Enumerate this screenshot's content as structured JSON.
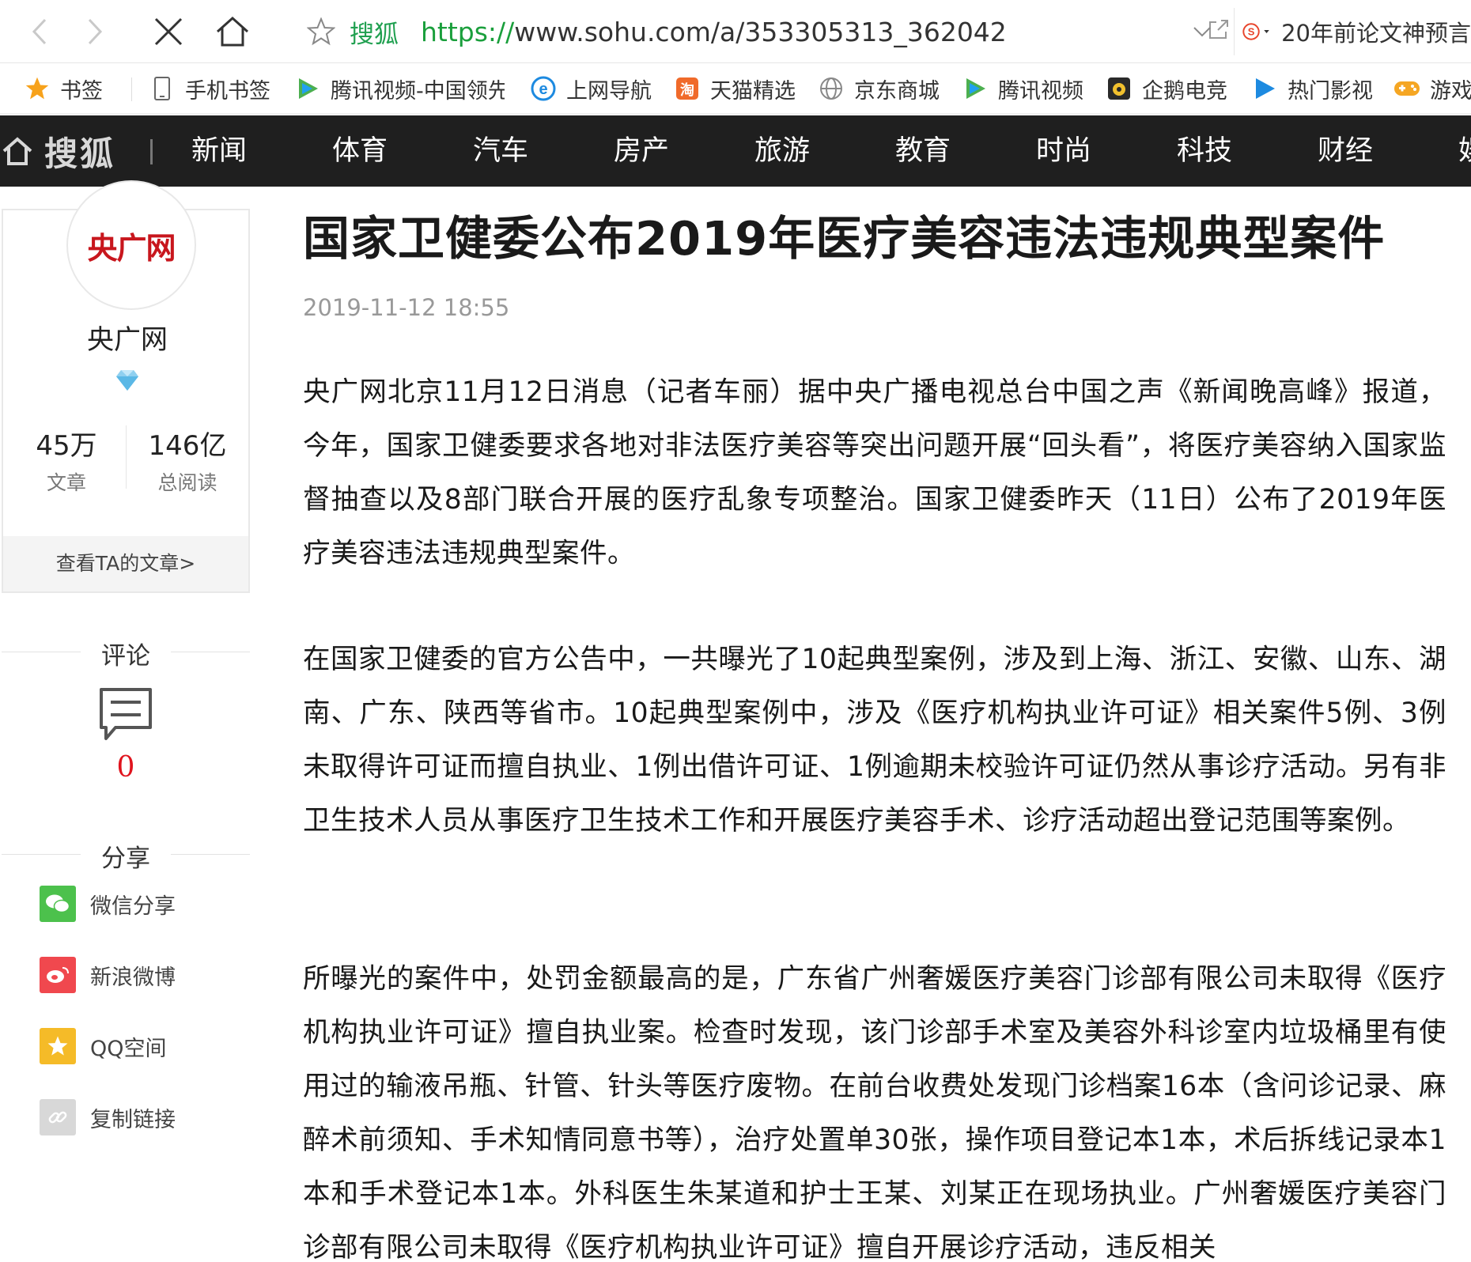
{
  "browser": {
    "url_site_label": "搜狐",
    "url_scheme": "https://",
    "url_rest": "www.sohu.com/a/353305313_362042",
    "search_text": "20年前论文神预言"
  },
  "bookmarks": [
    {
      "label": "书签",
      "icon": "star-icon"
    },
    {
      "label": "手机书签",
      "icon": "phone-icon"
    },
    {
      "label": "腾讯视频-中国领先",
      "icon": "tencent-video-icon"
    },
    {
      "label": "上网导航",
      "icon": "ie-icon"
    },
    {
      "label": "天猫精选",
      "icon": "tmall-icon"
    },
    {
      "label": "京东商城",
      "icon": "globe-icon"
    },
    {
      "label": "腾讯视频",
      "icon": "tencent-video-icon"
    },
    {
      "label": "企鹅电竞",
      "icon": "penguin-esports-icon"
    },
    {
      "label": "热门影视",
      "icon": "play-icon"
    },
    {
      "label": "游戏",
      "icon": "gamepad-icon"
    }
  ],
  "sohu_nav": {
    "logo": "搜狐",
    "items": [
      "新闻",
      "体育",
      "汽车",
      "房产",
      "旅游",
      "教育",
      "时尚",
      "科技",
      "财经",
      "娱乐"
    ]
  },
  "author": {
    "avatar_text": "央广网",
    "name": "央广网",
    "articles_value": "45万",
    "articles_label": "文章",
    "reads_value": "146亿",
    "reads_label": "总阅读",
    "view_link": "查看TA的文章>"
  },
  "comments": {
    "heading": "评论",
    "count": "0"
  },
  "share": {
    "heading": "分享",
    "items": [
      {
        "label": "微信分享",
        "color": "#4cc14c",
        "icon": "wechat-icon"
      },
      {
        "label": "新浪微博",
        "color": "#f0484e",
        "icon": "weibo-icon"
      },
      {
        "label": "QQ空间",
        "color": "#f5bb28",
        "icon": "qzone-icon"
      },
      {
        "label": "复制链接",
        "color": "#d8d8d8",
        "icon": "link-icon"
      }
    ]
  },
  "article": {
    "title": "国家卫健委公布2019年医疗美容违法违规典型案件",
    "date": "2019-11-12 18:55",
    "paragraphs": [
      "央广网北京11月12日消息（记者车丽）据中央广播电视总台中国之声《新闻晚高峰》报道，今年，国家卫健委要求各地对非法医疗美容等突出问题开展“回头看”，将医疗美容纳入国家监督抽查以及8部门联合开展的医疗乱象专项整治。国家卫健委昨天（11日）公布了2019年医疗美容违法违规典型案件。",
      "在国家卫健委的官方公告中，一共曝光了10起典型案例，涉及到上海、浙江、安徽、山东、湖南、广东、陕西等省市。10起典型案例中，涉及《医疗机构执业许可证》相关案件5例、3例未取得许可证而擅自执业、1例出借许可证、1例逾期未校验许可证仍然从事诊疗活动。另有非卫生技术人员从事医疗卫生技术工作和开展医疗美容手术、诊疗活动超出登记范围等案例。",
      "所曝光的案件中，处罚金额最高的是，广东省广州奢媛医疗美容门诊部有限公司未取得《医疗机构执业许可证》擅自执业案。检查时发现，该门诊部手术室及美容外科诊室内垃圾桶里有使用过的输液吊瓶、针管、针头等医疗废物。在前台收费处发现门诊档案16本（含问诊记录、麻醉术前须知、手术知情同意书等），治疗处置单30张，操作项目登记本1本，术后拆线记录本1本和手术登记本1本。外科医生朱某道和护士王某、刘某正在现场执业。广州奢媛医疗美容门诊部有限公司未取得《医疗机构执业许可证》擅自开展诊疗活动，违反相关"
    ]
  }
}
